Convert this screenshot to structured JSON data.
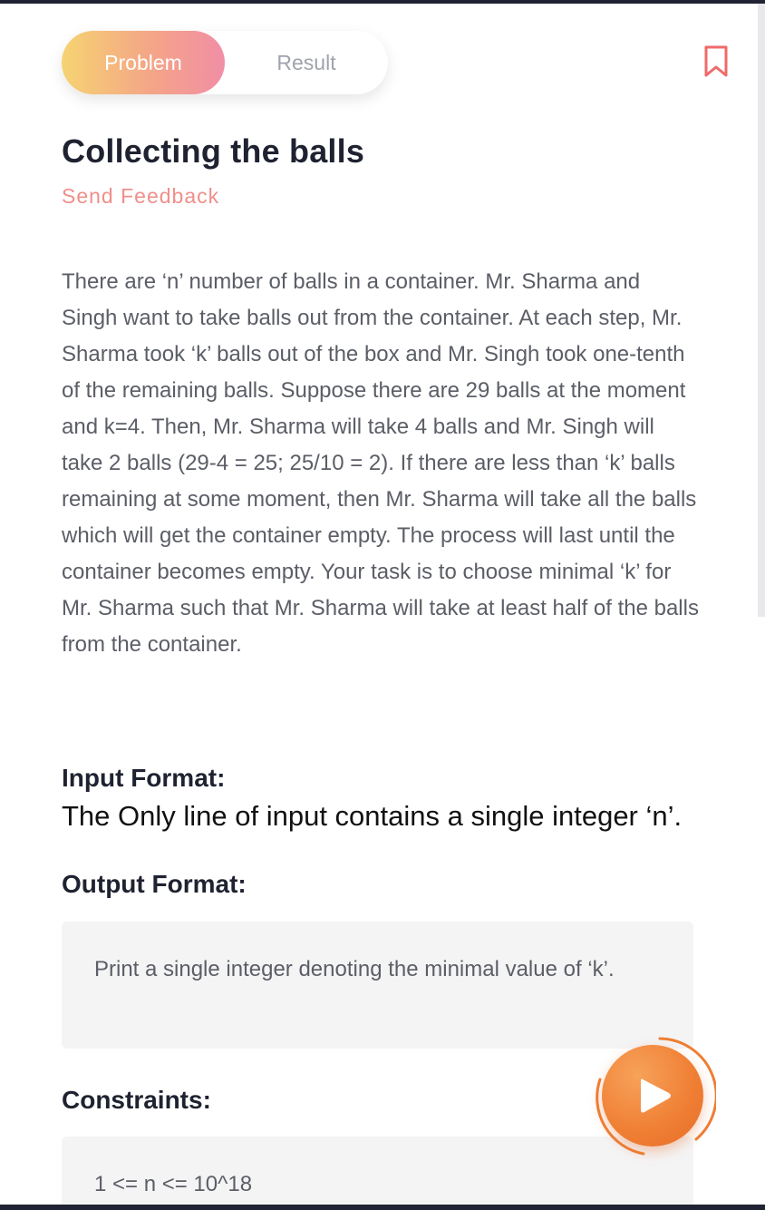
{
  "tabs": [
    {
      "label": "Problem",
      "active": true
    },
    {
      "label": "Result",
      "active": false
    }
  ],
  "problem": {
    "title": "Collecting the balls",
    "feedback_link": "Send Feedback",
    "description": "There are ‘n’ number of balls in a container. Mr. Sharma and Singh want to take balls out from the container. At each step, Mr. Sharma took ‘k’ balls out of the box and Mr. Singh took one-tenth of the remaining balls. Suppose there are 29 balls at the moment and k=4. Then, Mr. Sharma will take 4 balls and Mr. Singh will take 2 balls (29-4 = 25; 25/10 = 2). If there are less than ‘k’ balls remaining at some moment, then Mr. Sharma will take all the balls which will get the container empty. The process will last until the container becomes empty. Your task is to choose minimal ‘k’ for Mr. Sharma such that Mr. Sharma will take at least half of the balls from the container."
  },
  "input_format": {
    "label": "Input Format:",
    "text": "The Only line of input contains a single integer ‘n’."
  },
  "output_format": {
    "label": "Output Format:",
    "text": "Print a single integer denoting the minimal value of ‘k’."
  },
  "constraints": {
    "label": "Constraints:",
    "text": "1 <= n <= 10^18"
  },
  "icons": {
    "bookmark": "bookmark-icon",
    "run": "play-icon"
  },
  "colors": {
    "accent_orange": "#ef7e33",
    "feedback": "#ef8f8b",
    "tab_gradient_start": "#f6d372",
    "tab_gradient_end": "#f18ea6",
    "bookmark": "#ef6a6a"
  }
}
